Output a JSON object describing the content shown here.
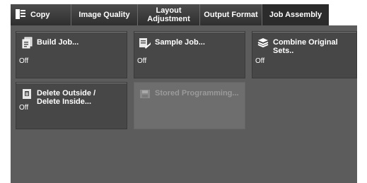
{
  "tabs": [
    {
      "label": "Copy"
    },
    {
      "label": "Image Quality"
    },
    {
      "label": "Layout\nAdjustment"
    },
    {
      "label": "Output Format"
    },
    {
      "label": "Job Assembly"
    }
  ],
  "buttons": [
    {
      "label": "Build Job...",
      "status": "Off",
      "icon": "build-job-icon"
    },
    {
      "label": "Sample Job...",
      "status": "Off",
      "icon": "sample-job-icon"
    },
    {
      "label": "Combine Original Sets..",
      "status": "Off",
      "icon": "combine-sets-icon"
    },
    {
      "label": "Delete Outside /\nDelete Inside...",
      "status": "Off",
      "icon": "delete-outside-icon"
    },
    {
      "label": "Stored Programming...",
      "status": "",
      "icon": "stored-programming-icon"
    }
  ]
}
